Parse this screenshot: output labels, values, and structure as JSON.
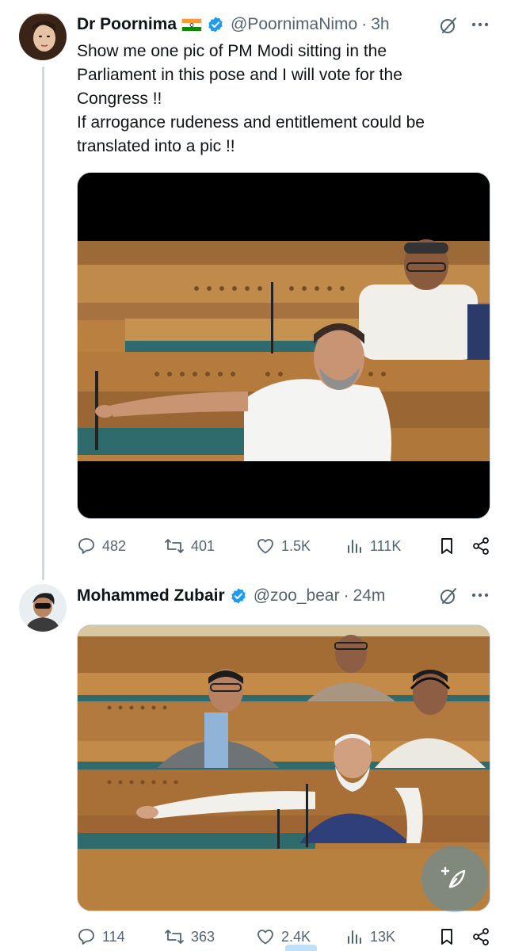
{
  "tweets": [
    {
      "display_name": "Dr Poornima",
      "handle": "@PoornimaNimo",
      "separator": "·",
      "time": "3h",
      "text_lines": [
        "Show me one pic of PM Modi sitting in the",
        "Parliament in this pose and I will vote for the",
        "Congress !!",
        "If arrogance rudeness and entitlement could be",
        "translated into a pic !!"
      ],
      "stats": {
        "replies": "482",
        "reposts": "401",
        "likes": "1.5K",
        "views": "111K"
      }
    },
    {
      "display_name": "Mohammed Zubair",
      "handle": "@zoo_bear",
      "separator": "·",
      "time": "24m",
      "stats": {
        "replies": "114",
        "reposts": "363",
        "likes": "2.4K",
        "views": "13K"
      }
    }
  ],
  "colors": {
    "text_primary": "#0f1419",
    "text_secondary": "#536471",
    "verified_blue": "#1d9bf0",
    "thread_line": "#cfd9de"
  },
  "icons": [
    "flag-india-icon",
    "verified-badge-icon",
    "grok-icon",
    "more-icon",
    "reply-icon",
    "repost-icon",
    "like-icon",
    "views-icon",
    "bookmark-icon",
    "share-icon",
    "compose-icon"
  ]
}
